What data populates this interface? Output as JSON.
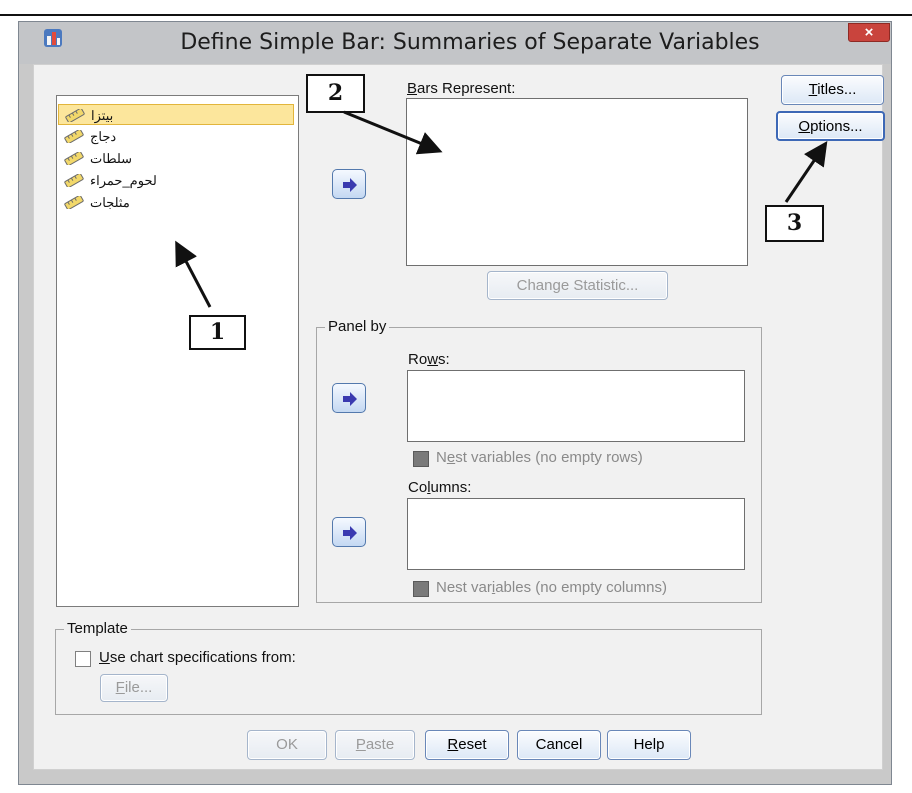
{
  "window": {
    "title": "Define Simple Bar: Summaries of Separate Variables",
    "close_label": "×"
  },
  "variables": [
    {
      "label": "بيتزا",
      "icon": "scale-ruler-icon",
      "selected": true
    },
    {
      "label": "دجاج",
      "icon": "scale-ruler-icon",
      "selected": false
    },
    {
      "label": "سلطات",
      "icon": "scale-ruler-icon",
      "selected": false
    },
    {
      "label": "لحوم_حمراء",
      "icon": "scale-ruler-icon",
      "selected": false
    },
    {
      "label": "مثلجات",
      "icon": "scale-ruler-icon",
      "selected": false
    }
  ],
  "bars_represent": {
    "label": "Bars Represent:",
    "mnemonic": "B",
    "rest": "ars Represent:"
  },
  "change_statistic": {
    "label": "Change Statistic...",
    "enabled": false
  },
  "panel_by": {
    "title": "Panel by",
    "rows": {
      "pre": "Ro",
      "mnemonic": "w",
      "post": "s:"
    },
    "nest_rows": {
      "pre": "N",
      "mnemonic": "e",
      "post": "st variables (no empty rows)",
      "checked": false,
      "enabled": false
    },
    "columns": {
      "pre": "Co",
      "mnemonic": "l",
      "post": "umns:"
    },
    "nest_columns": {
      "pre": "Nest var",
      "mnemonic": "i",
      "post": "ables (no empty columns)",
      "checked": false,
      "enabled": false
    }
  },
  "side_buttons": {
    "titles": {
      "mnemonic": "T",
      "rest": "itles..."
    },
    "options": {
      "mnemonic": "O",
      "rest": "ptions..."
    }
  },
  "template": {
    "title": "Template",
    "use_spec": {
      "mnemonic": "U",
      "rest": "se chart specifications from:",
      "checked": false
    },
    "file_button": {
      "mnemonic": "F",
      "rest": "ile...",
      "enabled": false
    }
  },
  "bottom_buttons": {
    "ok": "OK",
    "paste": {
      "mnemonic": "P",
      "rest": "aste"
    },
    "reset": {
      "mnemonic": "R",
      "rest": "eset"
    },
    "cancel": "Cancel",
    "help": "Help"
  },
  "callouts": [
    "1",
    "2",
    "3"
  ],
  "colors": {
    "selection": "#fce69c",
    "button_border": "#6987b8",
    "close_button": "#c9443d",
    "arrow_glyph": "#3a3ab0"
  }
}
